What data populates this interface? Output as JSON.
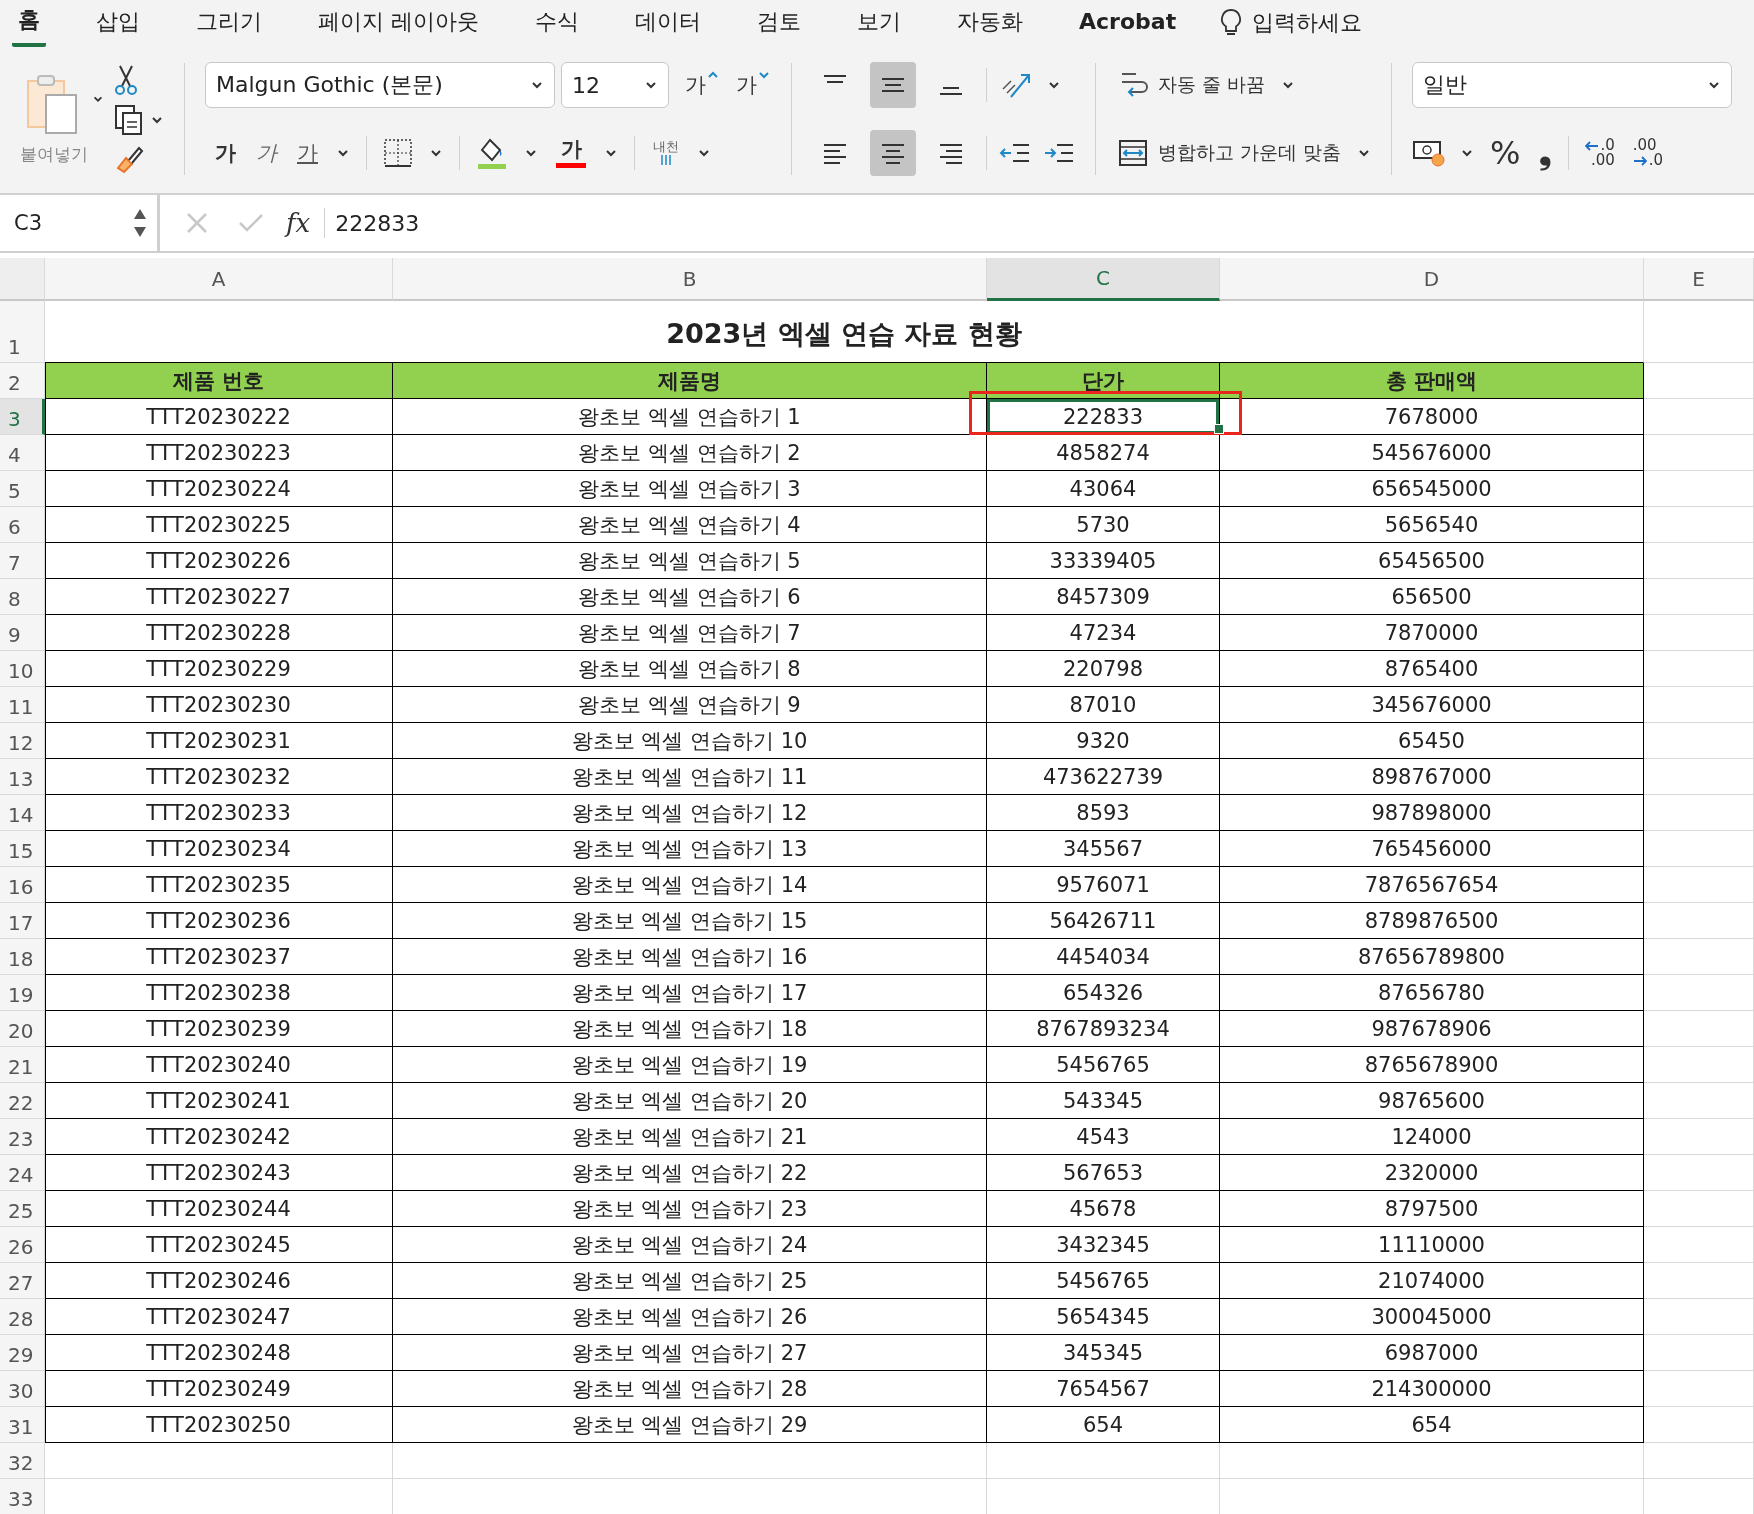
{
  "tabs": [
    {
      "label": "홈",
      "selected": true
    },
    {
      "label": "삽입",
      "selected": false
    },
    {
      "label": "그리기",
      "selected": false
    },
    {
      "label": "페이지 레이아웃",
      "selected": false
    },
    {
      "label": "수식",
      "selected": false
    },
    {
      "label": "데이터",
      "selected": false
    },
    {
      "label": "검토",
      "selected": false
    },
    {
      "label": "보기",
      "selected": false
    },
    {
      "label": "자동화",
      "selected": false
    },
    {
      "label": "Acrobat",
      "selected": false
    }
  ],
  "tell_me": {
    "placeholder": "입력하세요"
  },
  "ribbon": {
    "paste_label": "붙여넣기",
    "font_name": "Malgun Gothic (본문)",
    "font_size": "12",
    "grow_font": "가",
    "shrink_font": "가",
    "bold": "가",
    "italic": "가",
    "underline": "가",
    "font_color": "가",
    "phonetic": "내천",
    "vertical_align": [
      {
        "kind": "top",
        "selected": false
      },
      {
        "kind": "middle",
        "selected": true
      },
      {
        "kind": "bottom",
        "selected": false
      }
    ],
    "horizontal_align": [
      {
        "kind": "left",
        "selected": false
      },
      {
        "kind": "center",
        "selected": true
      },
      {
        "kind": "right",
        "selected": false
      }
    ],
    "wrap_text": "자동 줄 바꿈",
    "merge_center": "병합하고 가운데 맞춤",
    "number_format": "일반",
    "percent": "%",
    "comma": "❟",
    "increase_decimal": [
      ".0",
      ".00"
    ],
    "decrease_decimal": [
      ".00",
      ".0"
    ]
  },
  "formula_bar": {
    "name_box": "C3",
    "fx": "fx",
    "value": "222833"
  },
  "sheet": {
    "columns": [
      {
        "label": "A",
        "selected": false
      },
      {
        "label": "B",
        "selected": false
      },
      {
        "label": "C",
        "selected": true
      },
      {
        "label": "D",
        "selected": false
      },
      {
        "label": "E",
        "selected": false
      }
    ],
    "title_row": {
      "number": "1",
      "selected": false,
      "title": "2023년 엑셀 연습 자료 현황"
    },
    "header_row": {
      "number": "2",
      "selected": false,
      "cells": [
        "제품 번호",
        "제품명",
        "단가",
        "총 판매액"
      ]
    },
    "rows": [
      {
        "number": "3",
        "selected": true,
        "cells": [
          "TTT20230222",
          "왕초보 엑셀 연습하기 1",
          "222833",
          "7678000"
        ]
      },
      {
        "number": "4",
        "selected": false,
        "cells": [
          "TTT20230223",
          "왕초보 엑셀 연습하기 2",
          "4858274",
          "545676000"
        ]
      },
      {
        "number": "5",
        "selected": false,
        "cells": [
          "TTT20230224",
          "왕초보 엑셀 연습하기 3",
          "43064",
          "656545000"
        ]
      },
      {
        "number": "6",
        "selected": false,
        "cells": [
          "TTT20230225",
          "왕초보 엑셀 연습하기 4",
          "5730",
          "5656540"
        ]
      },
      {
        "number": "7",
        "selected": false,
        "cells": [
          "TTT20230226",
          "왕초보 엑셀 연습하기 5",
          "33339405",
          "65456500"
        ]
      },
      {
        "number": "8",
        "selected": false,
        "cells": [
          "TTT20230227",
          "왕초보 엑셀 연습하기 6",
          "8457309",
          "656500"
        ]
      },
      {
        "number": "9",
        "selected": false,
        "cells": [
          "TTT20230228",
          "왕초보 엑셀 연습하기 7",
          "47234",
          "7870000"
        ]
      },
      {
        "number": "10",
        "selected": false,
        "cells": [
          "TTT20230229",
          "왕초보 엑셀 연습하기 8",
          "220798",
          "8765400"
        ]
      },
      {
        "number": "11",
        "selected": false,
        "cells": [
          "TTT20230230",
          "왕초보 엑셀 연습하기 9",
          "87010",
          "345676000"
        ]
      },
      {
        "number": "12",
        "selected": false,
        "cells": [
          "TTT20230231",
          "왕초보 엑셀 연습하기 10",
          "9320",
          "65450"
        ]
      },
      {
        "number": "13",
        "selected": false,
        "cells": [
          "TTT20230232",
          "왕초보 엑셀 연습하기 11",
          "473622739",
          "898767000"
        ]
      },
      {
        "number": "14",
        "selected": false,
        "cells": [
          "TTT20230233",
          "왕초보 엑셀 연습하기 12",
          "8593",
          "987898000"
        ]
      },
      {
        "number": "15",
        "selected": false,
        "cells": [
          "TTT20230234",
          "왕초보 엑셀 연습하기 13",
          "345567",
          "765456000"
        ]
      },
      {
        "number": "16",
        "selected": false,
        "cells": [
          "TTT20230235",
          "왕초보 엑셀 연습하기 14",
          "9576071",
          "7876567654"
        ]
      },
      {
        "number": "17",
        "selected": false,
        "cells": [
          "TTT20230236",
          "왕초보 엑셀 연습하기 15",
          "56426711",
          "8789876500"
        ]
      },
      {
        "number": "18",
        "selected": false,
        "cells": [
          "TTT20230237",
          "왕초보 엑셀 연습하기 16",
          "4454034",
          "87656789800"
        ]
      },
      {
        "number": "19",
        "selected": false,
        "cells": [
          "TTT20230238",
          "왕초보 엑셀 연습하기 17",
          "654326",
          "87656780"
        ]
      },
      {
        "number": "20",
        "selected": false,
        "cells": [
          "TTT20230239",
          "왕초보 엑셀 연습하기 18",
          "8767893234",
          "987678906"
        ]
      },
      {
        "number": "21",
        "selected": false,
        "cells": [
          "TTT20230240",
          "왕초보 엑셀 연습하기 19",
          "5456765",
          "8765678900"
        ]
      },
      {
        "number": "22",
        "selected": false,
        "cells": [
          "TTT20230241",
          "왕초보 엑셀 연습하기 20",
          "543345",
          "98765600"
        ]
      },
      {
        "number": "23",
        "selected": false,
        "cells": [
          "TTT20230242",
          "왕초보 엑셀 연습하기 21",
          "4543",
          "124000"
        ]
      },
      {
        "number": "24",
        "selected": false,
        "cells": [
          "TTT20230243",
          "왕초보 엑셀 연습하기 22",
          "567653",
          "2320000"
        ]
      },
      {
        "number": "25",
        "selected": false,
        "cells": [
          "TTT20230244",
          "왕초보 엑셀 연습하기 23",
          "45678",
          "8797500"
        ]
      },
      {
        "number": "26",
        "selected": false,
        "cells": [
          "TTT20230245",
          "왕초보 엑셀 연습하기 24",
          "3432345",
          "11110000"
        ]
      },
      {
        "number": "27",
        "selected": false,
        "cells": [
          "TTT20230246",
          "왕초보 엑셀 연습하기 25",
          "5456765",
          "21074000"
        ]
      },
      {
        "number": "28",
        "selected": false,
        "cells": [
          "TTT20230247",
          "왕초보 엑셀 연습하기 26",
          "5654345",
          "300045000"
        ]
      },
      {
        "number": "29",
        "selected": false,
        "cells": [
          "TTT20230248",
          "왕초보 엑셀 연습하기 27",
          "345345",
          "6987000"
        ]
      },
      {
        "number": "30",
        "selected": false,
        "cells": [
          "TTT20230249",
          "왕초보 엑셀 연습하기 28",
          "7654567",
          "214300000"
        ]
      },
      {
        "number": "31",
        "selected": false,
        "cells": [
          "TTT20230250",
          "왕초보 엑셀 연습하기 29",
          "654",
          "654"
        ]
      }
    ],
    "empty_rows": [
      {
        "number": "32",
        "selected": false
      },
      {
        "number": "33",
        "selected": false
      }
    ],
    "highlight_active_cell": true
  }
}
